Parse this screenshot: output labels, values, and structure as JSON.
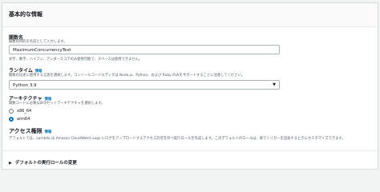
{
  "section": {
    "title": "基本的な情報"
  },
  "function_name": {
    "label": "関数名",
    "description": "関数の目的を名前として入力します。",
    "value": "MaximumConcurrencyTest",
    "hint": "文字、数字、ハイフン、アンダースコアのみ使用可能で、スペースは使用できません。"
  },
  "runtime": {
    "label": "ランタイム",
    "info": "情報",
    "description": "関数の記述に使用する言語を選択します。コンソールコードエディタは Node.js、Python、および Ruby のみをサポートすることに注意してください。",
    "selected": "Python 3.9"
  },
  "architecture": {
    "label": "アーキテクチャ",
    "info": "情報",
    "description": "関数コードに必要な命令セットアーキテクチャを選択します。",
    "options": [
      {
        "label": "x86_64",
        "selected": false
      },
      {
        "label": "arm64",
        "selected": true
      }
    ]
  },
  "permissions": {
    "label": "アクセス権限",
    "info": "情報",
    "description": "デフォルトでは、Lambda は Amazon CloudWatch Logs にログをアップロードするアクセス許可を持つ実行ロールを作成します。このデフォルトのロールは、後でトリガーを追加するときにカスタマイズできます。"
  },
  "expander": {
    "label": "デフォルトの実行ロールの変更",
    "icon": "caret-right-icon"
  }
}
